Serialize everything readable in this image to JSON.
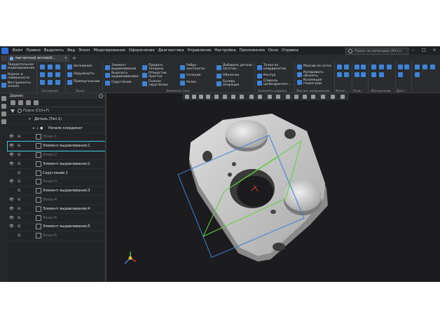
{
  "menu": {
    "items": [
      "Файл",
      "Правка",
      "Выделить",
      "Вид",
      "Эскиз",
      "Моделирование",
      "Оформление",
      "Диагностика",
      "Управление",
      "Настройка",
      "Приложения",
      "Окно",
      "Справка"
    ],
    "search_placeholder": "Поиск по командам (Alt+/)",
    "window_buttons": [
      "–",
      "□",
      "×"
    ]
  },
  "tabs": {
    "document_tab": "магнитный антивоб...",
    "close_glyph": "×",
    "add_glyph": "+"
  },
  "ribbon": {
    "left_panel": {
      "title": "Твердотельное моделирование",
      "item1": "Каркас и поверхности",
      "item2": "Инструменты эскиза"
    },
    "btn_autoline": "Автолиния",
    "btn_circle": "Окружность",
    "btn_rect": "Прямоугольник",
    "btn_extrude": "Элемент выдавливания",
    "btn_cut_extrude": "Вырезать выдавливанием",
    "btn_fillet": "Скругление",
    "btn_thicken": "Придать толщину",
    "btn_hole": "Отверстие простое",
    "btn_full_round": "Полное скругление",
    "btn_rib": "Ребро жесткости",
    "btn_section": "Сечение",
    "btn_slope": "Уклон",
    "btn_add_part": "Добавить деталь-заготов...",
    "btn_shell": "Оболочка",
    "btn_boolean": "Булева операция",
    "btn_point": "Точка по координатам",
    "btn_contour": "Контур",
    "btn_spiral": "Спираль цилиндрическ...",
    "btn_arrays": "Массив по сетке",
    "btn_copy": "Копировать объекты",
    "btn_collection": "Коллекция геометрии",
    "group_system": "Системная",
    "group_sketch": "Эскиз",
    "group_body": "Элементы тела",
    "group_frame": "Элементы каркаса",
    "group_arrays": "Массив, копирование",
    "group_foton": "Фотон...",
    "group_size": "Разм...",
    "group_notation": "Обозначение",
    "group_diag": "Диаг..."
  },
  "tree": {
    "title": "Дерево",
    "search_placeholder": "Поиск (Ctrl+F)",
    "rows": [
      {
        "label": "Деталь (Тел-1)",
        "eye": "",
        "rel": "",
        "prefix": "▾",
        "state": "active"
      },
      {
        "label": "Начало координат",
        "eye": "",
        "rel": "",
        "prefix": "▸ ⊥ ●",
        "state": "active"
      },
      {
        "label": "Эскиз:1",
        "eye": "👁",
        "rel": "∈",
        "prefix": "",
        "state": "dim"
      },
      {
        "label": "Элемент выдавливания:1",
        "eye": "👁",
        "rel": "∈",
        "prefix": "",
        "state": "active",
        "selected": true
      },
      {
        "label": "Эскиз:2",
        "eye": "👁",
        "rel": "∈",
        "prefix": "",
        "state": "dim"
      },
      {
        "label": "Элемент выдавливания:2",
        "eye": "👁",
        "rel": "∈",
        "prefix": "",
        "state": "active"
      },
      {
        "label": "Скругление:1",
        "eye": "",
        "rel": "∈",
        "prefix": "",
        "state": "active"
      },
      {
        "label": "Эскиз:3",
        "eye": "👁",
        "rel": "∈",
        "prefix": "",
        "state": "dim"
      },
      {
        "label": "Элемент выдавливания:3",
        "eye": "",
        "rel": "∈",
        "prefix": "",
        "state": "active"
      },
      {
        "label": "Эскиз:4",
        "eye": "👁",
        "rel": "∈",
        "prefix": "",
        "state": "dim"
      },
      {
        "label": "Элемент выдавливания:4",
        "eye": "👁",
        "rel": "∈",
        "prefix": "",
        "state": "active"
      },
      {
        "label": "Эскиз:5",
        "eye": "👁",
        "rel": "∈",
        "prefix": "",
        "state": "dim"
      },
      {
        "label": "Элемент выдавливания:5",
        "eye": "👁",
        "rel": "∈",
        "prefix": "",
        "state": "active"
      },
      {
        "label": "Эскиз:6",
        "eye": "",
        "rel": "∈",
        "prefix": "",
        "state": "dim"
      }
    ]
  },
  "viewport": {
    "axes": {
      "x_color": "#d03a2f",
      "y_color": "#49b84a",
      "z_color": "#e8c13a"
    }
  },
  "colors": {
    "accent": "#3d84d8",
    "selection": "#3fc4d6",
    "background": "#1e1f21"
  }
}
